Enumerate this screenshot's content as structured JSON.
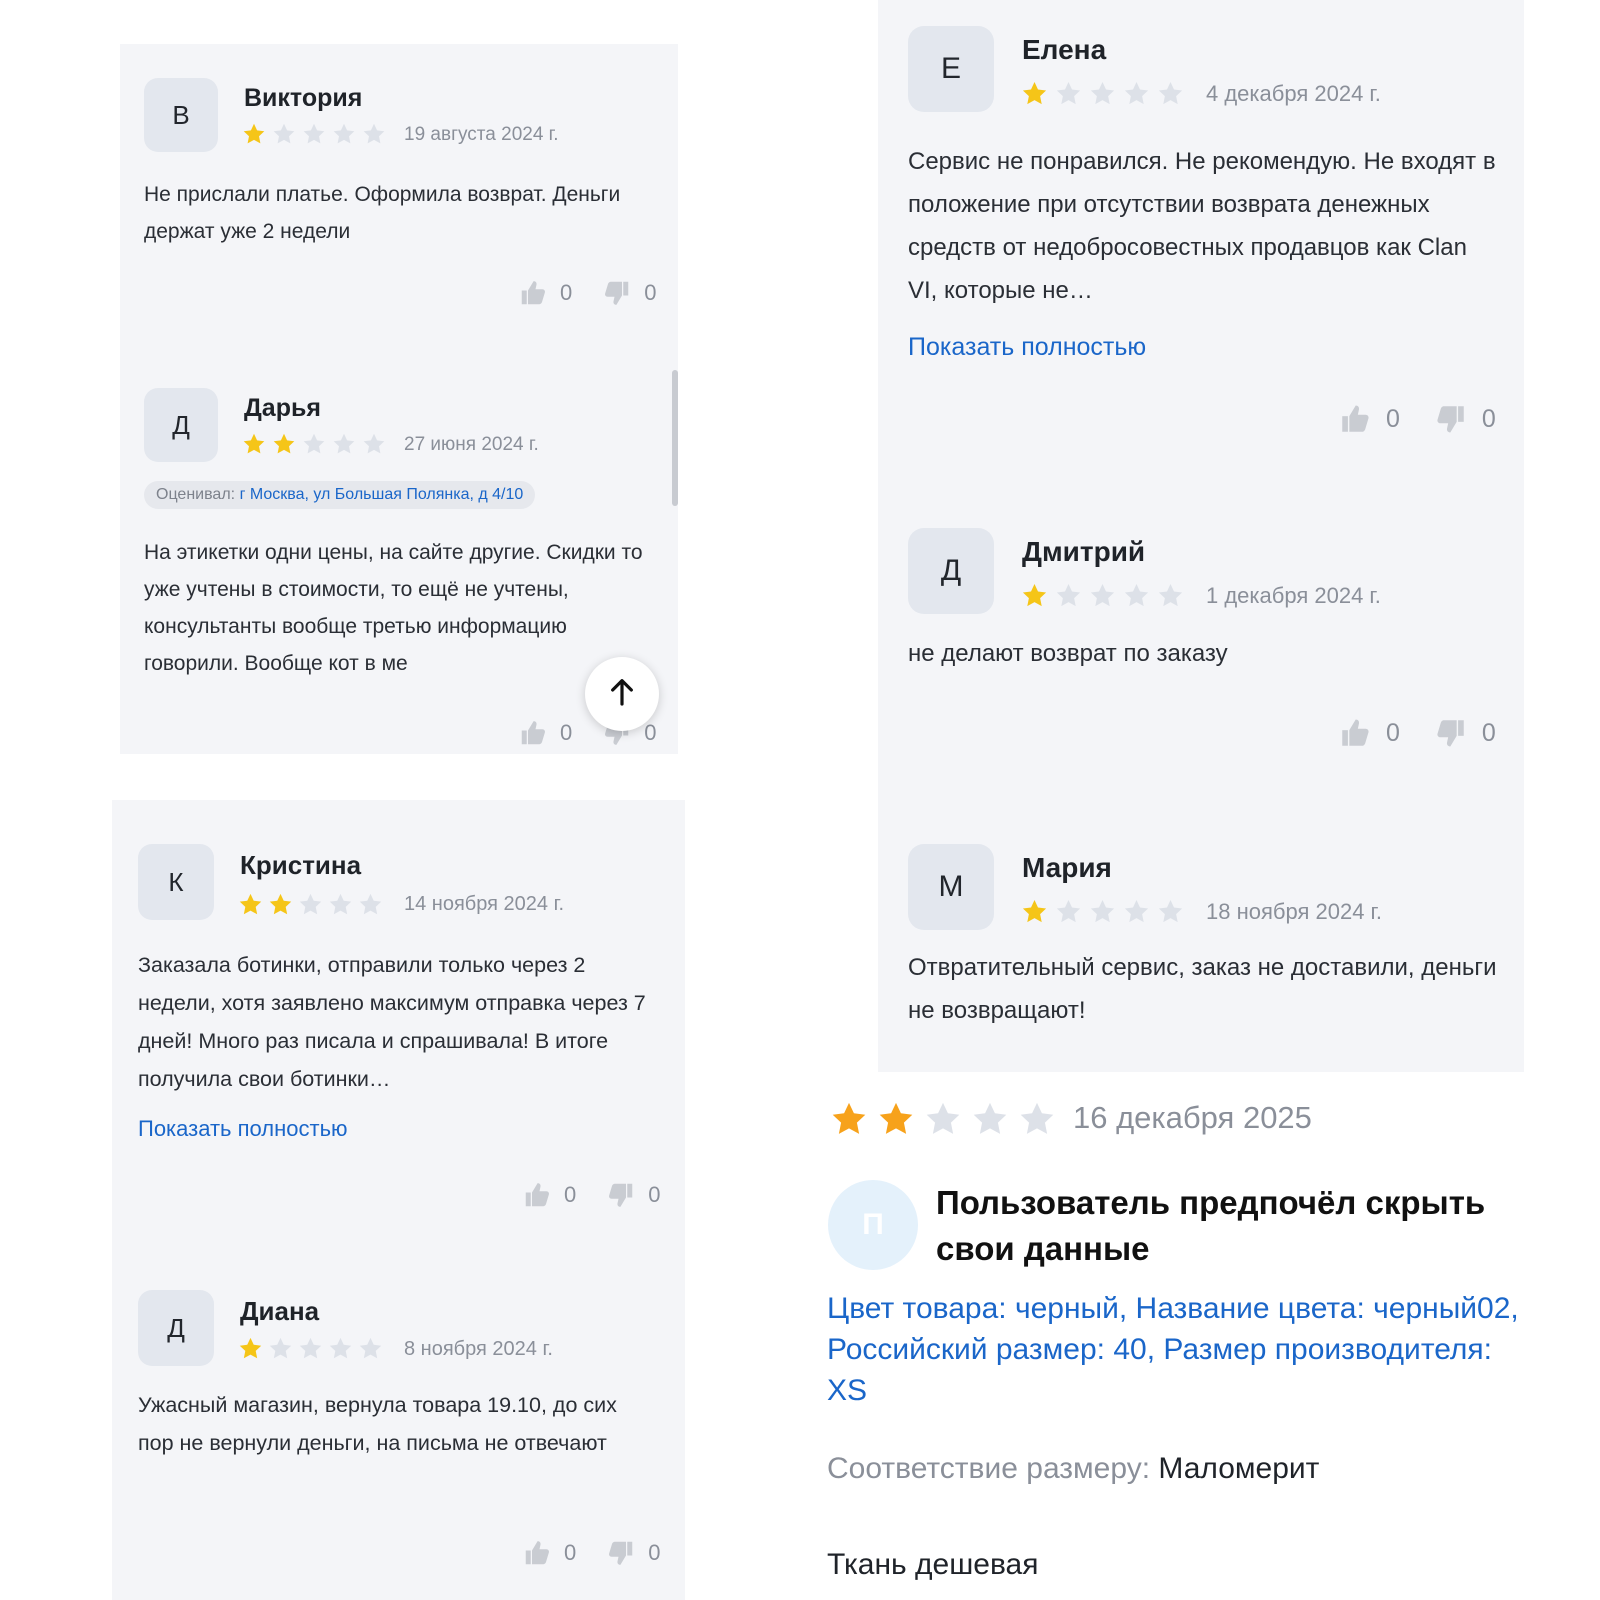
{
  "colors": {
    "star_filled": "#f5c518",
    "star_filled_orange": "#f7a21b",
    "star_empty": "#dde1e8",
    "link": "#1a66c9",
    "panel_bg": "#f4f5f8"
  },
  "icons": {
    "like": "thumb-up-icon",
    "dislike": "thumb-down-icon",
    "scroll_up": "arrow-up-icon"
  },
  "left_top": {
    "reviews": [
      {
        "avatar": "В",
        "name": "Виктория",
        "rating": 1,
        "date": "19 августа 2024 г.",
        "text": "Не прислали платье. Оформила возврат. Деньги держат уже 2 недели",
        "likes": "0",
        "dislikes": "0"
      },
      {
        "avatar": "Д",
        "name": "Дарья",
        "rating": 2,
        "date": "27 июня 2024 г.",
        "tag_label": "Оценивал:",
        "tag_location": "г Москва, ул Большая Полянка, д 4/10",
        "text": "На этикетки одни цены, на сайте другие. Скидки то уже учтены в стоимости, то ещё не учтены, консультанты вообще третью информацию говорили. Вообще кот в ме",
        "likes": "0",
        "dislikes": "0"
      }
    ]
  },
  "left_bottom": {
    "reviews": [
      {
        "avatar": "К",
        "name": "Кристина",
        "rating": 2,
        "date": "14 ноября 2024 г.",
        "text": "Заказала ботинки, отправили только через 2 недели, хотя заявлено максимум отправка через 7 дней! Много раз писала и спрашивала! В итоге получила свои ботинки…",
        "show_more": "Показать полностью",
        "likes": "0",
        "dislikes": "0"
      },
      {
        "avatar": "Д",
        "name": "Диана",
        "rating": 1,
        "date": "8 ноября 2024 г.",
        "text": "Ужасный магазин, вернула товара 19.10, до сих пор не вернули деньги, на письма не отвечают",
        "likes": "0",
        "dislikes": "0"
      }
    ]
  },
  "right_top": {
    "reviews": [
      {
        "avatar": "Е",
        "name": "Елена",
        "rating": 1,
        "date": "4 декабря 2024 г.",
        "text": "Сервис не понравился. Не рекомендую. Не входят в положение при отсутствии возврата денежных средств от недобросовестных продавцов как Clan VI, которые не…",
        "show_more": "Показать полностью",
        "likes": "0",
        "dislikes": "0"
      },
      {
        "avatar": "Д",
        "name": "Дмитрий",
        "rating": 1,
        "date": "1 декабря 2024 г.",
        "text": "не делают возврат по заказу",
        "likes": "0",
        "dislikes": "0"
      },
      {
        "avatar": "М",
        "name": "Мария",
        "rating": 1,
        "date": "18 ноября 2024 г.",
        "text": "Отвратительный сервис, заказ не доставили, деньги не возвращают!"
      }
    ]
  },
  "standalone": {
    "rating": 2,
    "date": "16 декабря 2025",
    "avatar": "П",
    "user": "Пользователь предпочёл скрыть свои данные",
    "attributes": "Цвет товара: черный, Название цвета: черный02, Российский размер: 40, Размер производителя: XS",
    "fit_label": "Соответствие размеру:",
    "fit_value": "Маломерит",
    "comment": "Ткань дешевая"
  }
}
